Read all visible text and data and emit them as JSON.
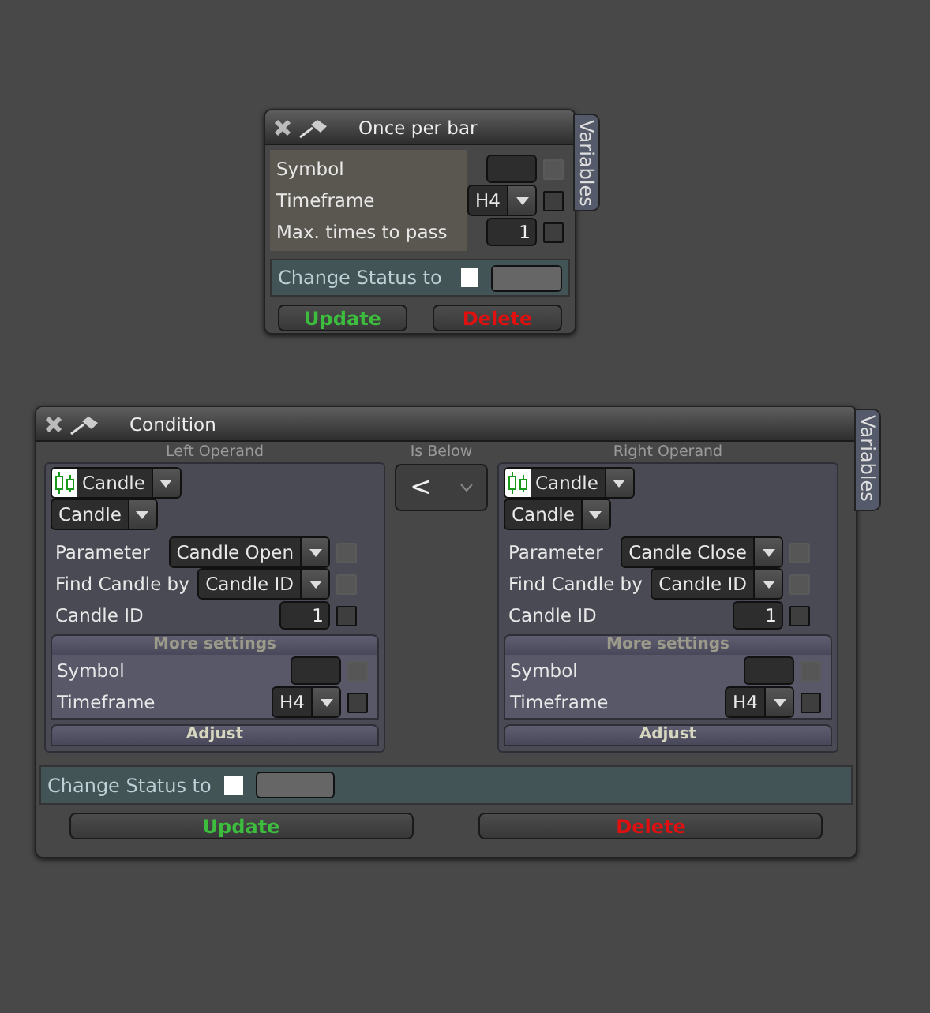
{
  "windows": [
    {
      "kind": "once",
      "title": "Once per bar",
      "side_tab": "Variables",
      "fields": [
        {
          "label": "Symbol",
          "kind": "input",
          "checkbox": {
            "checked": false,
            "disabled": true
          }
        },
        {
          "label": "Timeframe",
          "kind": "select",
          "value": "H4",
          "checkbox": {
            "checked": false,
            "disabled": false
          }
        },
        {
          "label": "Max. times to pass",
          "kind": "input",
          "value": "1",
          "checkbox": {
            "checked": false,
            "disabled": false
          }
        }
      ],
      "status": {
        "label": "Change Status to",
        "checked": false
      },
      "buttons": [
        {
          "label": "Update",
          "kind": "update"
        },
        {
          "label": "Delete",
          "kind": "delete"
        }
      ]
    },
    {
      "kind": "condition",
      "title": "Condition",
      "side_tab": "Variables",
      "operands": [
        {
          "heading": "Left Operand",
          "source": "Candle",
          "type": "Candle",
          "fields": [
            {
              "label": "Parameter",
              "kind": "select",
              "value": "Candle Open",
              "checkbox": {
                "checked": false,
                "disabled": true
              }
            },
            {
              "label": "Find Candle by",
              "kind": "select",
              "value": "Candle ID",
              "checkbox": {
                "checked": false,
                "disabled": true
              }
            },
            {
              "label": "Candle ID",
              "kind": "input",
              "value": "1",
              "checkbox": {
                "checked": false,
                "disabled": false
              }
            }
          ],
          "more_settings": {
            "title": "More settings",
            "fields": [
              {
                "label": "Symbol",
                "kind": "input",
                "checkbox": {
                  "checked": false,
                  "disabled": true
                }
              },
              {
                "label": "Timeframe",
                "kind": "select",
                "value": "H4",
                "checkbox": {
                  "checked": false,
                  "disabled": false
                }
              }
            ]
          },
          "adjust": "Adjust"
        },
        {
          "heading": "Right Operand",
          "source": "Candle",
          "type": "Candle",
          "fields": [
            {
              "label": "Parameter",
              "kind": "select",
              "value": "Candle Close",
              "checkbox": {
                "checked": false,
                "disabled": true
              }
            },
            {
              "label": "Find Candle by",
              "kind": "select",
              "value": "Candle ID",
              "checkbox": {
                "checked": false,
                "disabled": true
              }
            },
            {
              "label": "Candle ID",
              "kind": "input",
              "value": "1",
              "checkbox": {
                "checked": false,
                "disabled": false
              }
            }
          ],
          "more_settings": {
            "title": "More settings",
            "fields": [
              {
                "label": "Symbol",
                "kind": "input",
                "checkbox": {
                  "checked": false,
                  "disabled": true
                }
              },
              {
                "label": "Timeframe",
                "kind": "select",
                "value": "H4",
                "checkbox": {
                  "checked": false,
                  "disabled": false
                }
              }
            ]
          },
          "adjust": "Adjust"
        }
      ],
      "comparator": {
        "heading": "Is Below",
        "value": "<"
      },
      "status": {
        "label": "Change Status to",
        "checked": false
      },
      "buttons": [
        {
          "label": "Update",
          "kind": "update"
        },
        {
          "label": "Delete",
          "kind": "delete"
        }
      ]
    }
  ]
}
